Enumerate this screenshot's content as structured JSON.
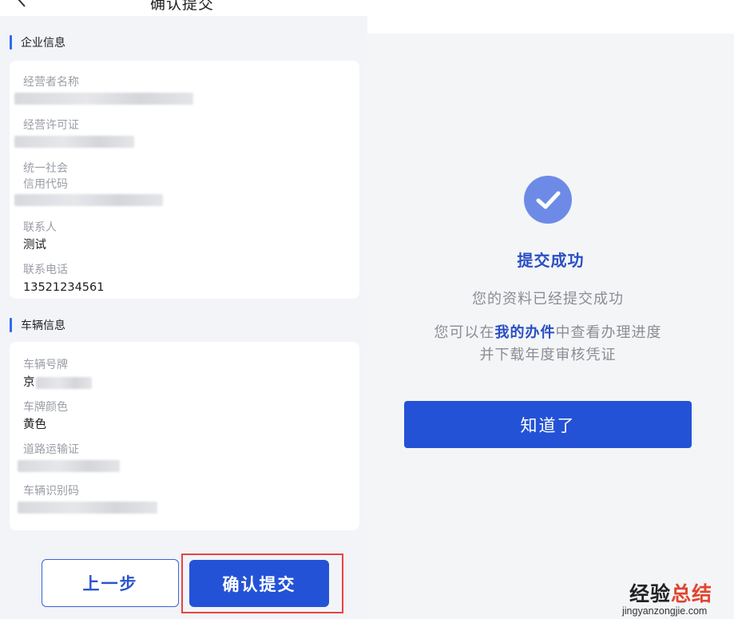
{
  "header": {
    "title": "确认提交"
  },
  "enterprise": {
    "section_title": "企业信息",
    "fields": [
      {
        "label": "经营者名称",
        "value": ""
      },
      {
        "label": "经营许可证",
        "value": ""
      },
      {
        "label_line1": "统一社会",
        "label_line2": "信用代码",
        "value": ""
      },
      {
        "label": "联系人",
        "value": "测试"
      },
      {
        "label": "联系电话",
        "value": "13521234561"
      }
    ]
  },
  "vehicle": {
    "section_title": "车辆信息",
    "fields": [
      {
        "label": "车辆号牌",
        "value_prefix": "京"
      },
      {
        "label": "车牌颜色",
        "value": "黄色"
      },
      {
        "label": "道路运输证",
        "value": ""
      },
      {
        "label": "车辆识别码",
        "value": ""
      }
    ]
  },
  "actions": {
    "prev_label": "上一步",
    "confirm_label": "确认提交"
  },
  "result": {
    "title": "提交成功",
    "message": "您的资料已经提交成功",
    "hint_prefix": "您可以在",
    "hint_link": "我的办件",
    "hint_suffix": "中查看办理进度",
    "hint_line2": "并下载年度审核凭证",
    "ok_label": "知道了"
  },
  "watermark": {
    "part1": "经验",
    "part2": "总结",
    "domain": "jingyanzongjie.com"
  },
  "icons": {
    "back": "chevron-left-icon",
    "success": "check-circle-icon"
  },
  "colors": {
    "primary": "#2452d6",
    "link": "#2a4fc4",
    "highlight": "#e54545",
    "success_circle": "#6d8be6"
  }
}
